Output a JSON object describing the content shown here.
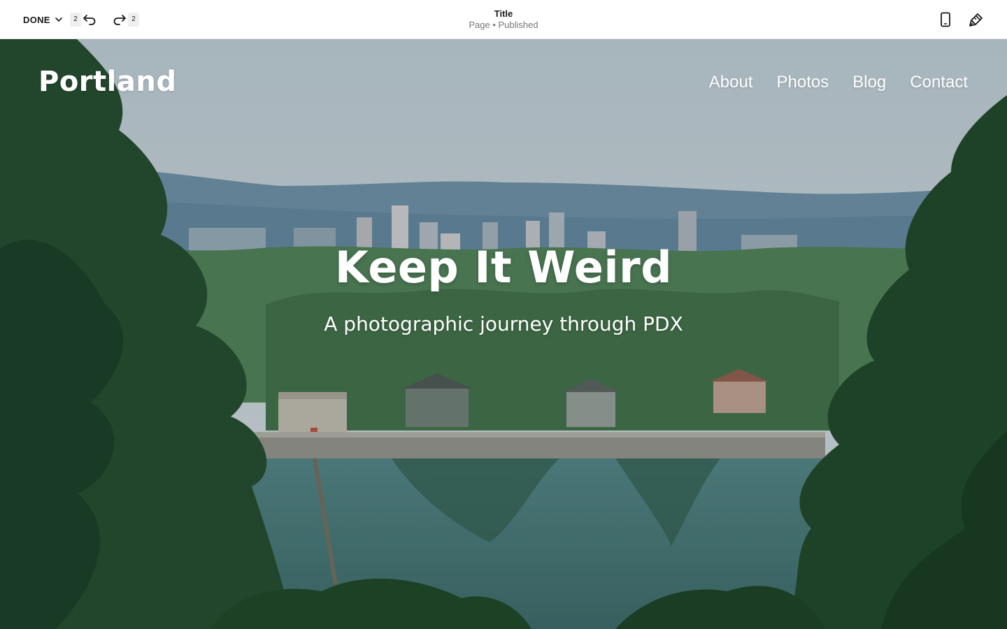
{
  "toolbar": {
    "done_label": "DONE",
    "undo_count": "2",
    "redo_count": "2",
    "page_title": "Title",
    "page_status": "Page • Published",
    "icons": {
      "done_menu": "chevron-down-icon",
      "undo": "undo-arrow-icon",
      "redo": "redo-arrow-icon",
      "mobile_preview": "mobile-phone-icon",
      "site_styles": "paintbrush-icon"
    }
  },
  "site": {
    "logo": "Portland",
    "nav": [
      "About",
      "Photos",
      "Blog",
      "Contact"
    ],
    "hero": {
      "heading": "Keep It Weird",
      "subheading": "A photographic journey through PDX"
    }
  },
  "colors": {
    "toolbar_bg": "#ffffff",
    "toolbar_text": "#1a1a1a",
    "status_text": "#777777",
    "badge_bg": "#efefef",
    "site_text": "#ffffff"
  }
}
